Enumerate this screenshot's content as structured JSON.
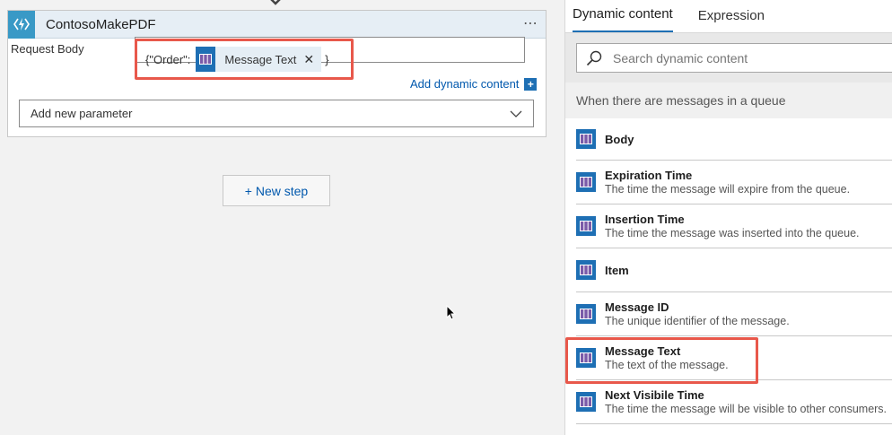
{
  "card": {
    "title": "ContosoMakePDF",
    "more": "⋯",
    "field_label": "Request Body",
    "body_prefix": "{\"Order\":",
    "body_token": "Message Text",
    "token_close": "✕",
    "body_suffix": "}",
    "add_dynamic": "Add dynamic content",
    "add_param": "Add new parameter"
  },
  "new_step": "+ New step",
  "panel": {
    "tabs": [
      {
        "label": "Dynamic content",
        "active": true
      },
      {
        "label": "Expression",
        "active": false
      }
    ],
    "search_placeholder": "Search dynamic content",
    "section": "When there are messages in a queue",
    "items": [
      {
        "name": "Body",
        "desc": ""
      },
      {
        "name": "Expiration Time",
        "desc": "The time the message will expire from the queue."
      },
      {
        "name": "Insertion Time",
        "desc": "The time the message was inserted into the queue."
      },
      {
        "name": "Item",
        "desc": ""
      },
      {
        "name": "Message ID",
        "desc": "The unique identifier of the message."
      },
      {
        "name": "Message Text",
        "desc": "The text of the message."
      },
      {
        "name": "Next Visibile Time",
        "desc": "The time the message will be visible to other consumers."
      }
    ]
  },
  "colors": {
    "accent": "#1e6fb4",
    "highlight": "#e8584b",
    "link": "#0058ad"
  }
}
